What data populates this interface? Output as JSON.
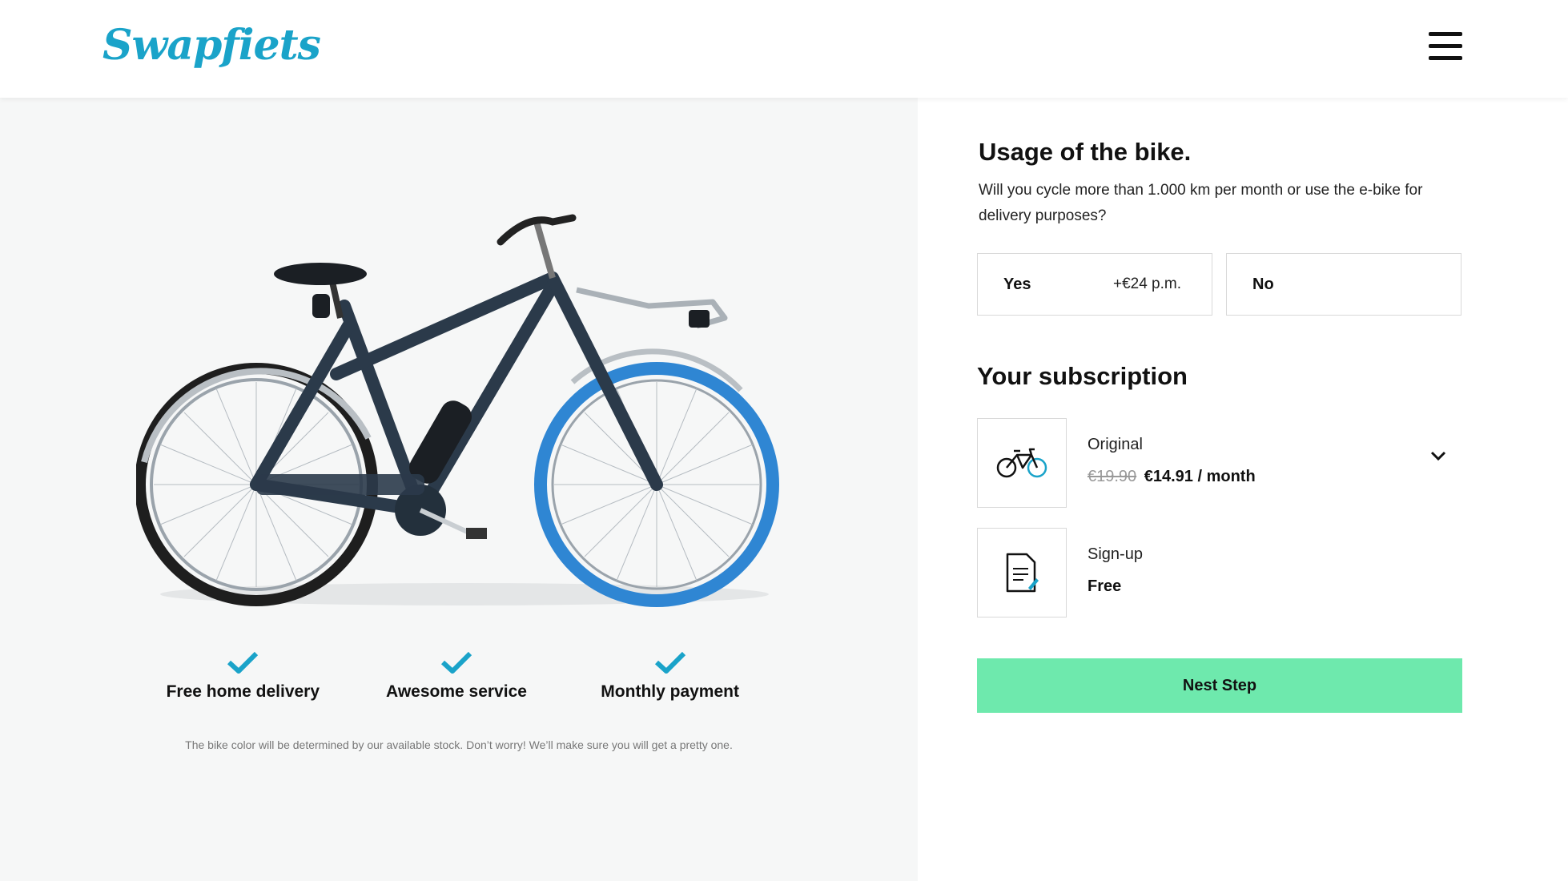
{
  "header": {
    "logo_text": "Swapfiets",
    "menu_icon": "hamburger-menu-icon"
  },
  "features": [
    {
      "label": "Free home delivery",
      "icon": "checkmark-icon"
    },
    {
      "label": "Awesome service",
      "icon": "checkmark-icon"
    },
    {
      "label": "Monthly payment",
      "icon": "checkmark-icon"
    }
  ],
  "note": "The bike color will be determined by our available stock. Don’t worry! We’ll make sure you will get a pretty one.",
  "usage": {
    "title": "Usage of the bike.",
    "description": "Will you cycle more than 1.000 km per month or use the e-bike for delivery purposes?",
    "options": [
      {
        "label": "Yes",
        "price": "+€24 p.m."
      },
      {
        "label": "No",
        "price": ""
      }
    ]
  },
  "subscription": {
    "title": "Your subscription",
    "items": [
      {
        "name": "Original",
        "old_price": "€19.90",
        "price": "€14.91 / month",
        "icon": "bicycle-icon"
      },
      {
        "name": "Sign-up",
        "price": "Free",
        "icon": "document-icon"
      }
    ]
  },
  "next_button": "Nest Step",
  "colors": {
    "brand": "#1aa3c9",
    "cta": "#6ee9ad",
    "left_bg": "#f6f7f7",
    "frame": "#2b3a4a",
    "front_tire": "#2f86d3"
  }
}
